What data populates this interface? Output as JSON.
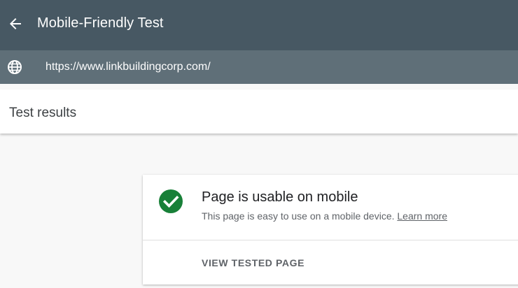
{
  "header": {
    "title": "Mobile-Friendly Test",
    "back_icon": "arrow-left-icon"
  },
  "url_bar": {
    "icon": "globe-icon",
    "value": "https://www.linkbuildingcorp.com/"
  },
  "results": {
    "title": "Test results"
  },
  "result_card": {
    "status_icon": "check-circle-icon",
    "status_color": "#188038",
    "title": "Page is usable on mobile",
    "description": "This page is easy to use on a mobile device.",
    "learn_more_label": "Learn more",
    "view_button_label": "VIEW TESTED PAGE"
  },
  "colors": {
    "topbar": "#475863",
    "urlbar": "#5f6f78",
    "background": "#f8f8f8"
  }
}
